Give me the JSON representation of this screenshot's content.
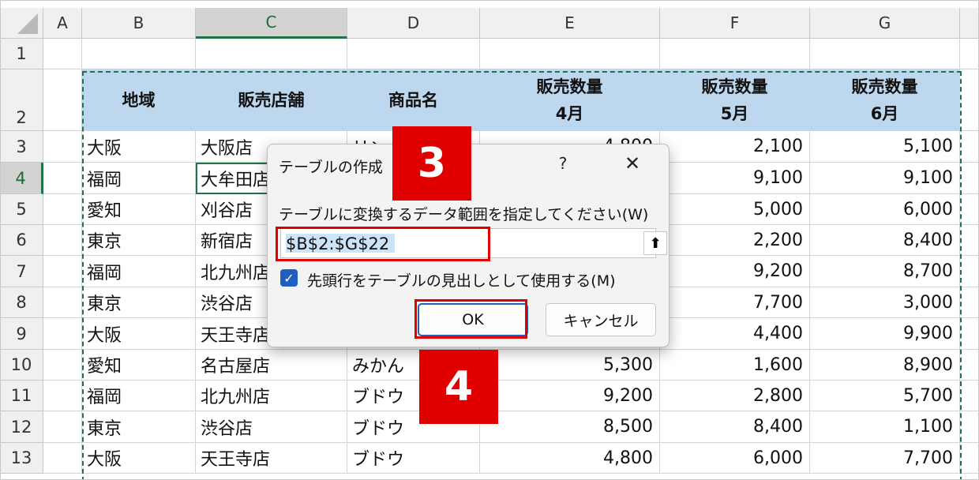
{
  "columns": [
    "A",
    "B",
    "C",
    "D",
    "E",
    "F",
    "G"
  ],
  "rows": [
    "1",
    "2",
    "3",
    "4",
    "5",
    "6",
    "7",
    "8",
    "9",
    "10",
    "11",
    "12",
    "13"
  ],
  "header_row": {
    "region": "地域",
    "store": "販売店舗",
    "product": "商品名",
    "apr": [
      "販売数量",
      "4月"
    ],
    "may": [
      "販売数量",
      "5月"
    ],
    "jun": [
      "販売数量",
      "6月"
    ]
  },
  "data_rows": [
    [
      "大阪",
      "大阪店",
      "リン",
      "4,800",
      "2,100",
      "5,100"
    ],
    [
      "福岡",
      "大牟田店",
      "",
      "",
      "9,100",
      "9,100"
    ],
    [
      "愛知",
      "刈谷店",
      "",
      "",
      "5,000",
      "6,000"
    ],
    [
      "東京",
      "新宿店",
      "",
      "",
      "2,200",
      "8,400"
    ],
    [
      "福岡",
      "北九州店",
      "",
      "",
      "9,200",
      "8,700"
    ],
    [
      "東京",
      "渋谷店",
      "",
      "",
      "7,700",
      "3,000"
    ],
    [
      "大阪",
      "天王寺店",
      "",
      "",
      "4,400",
      "9,900"
    ],
    [
      "愛知",
      "名古屋店",
      "みかん",
      "5,300",
      "1,600",
      "8,900"
    ],
    [
      "福岡",
      "北九州店",
      "ブドウ",
      "9,200",
      "2,800",
      "5,700"
    ],
    [
      "東京",
      "渋谷店",
      "ブドウ",
      "8,500",
      "8,400",
      "1,100"
    ],
    [
      "大阪",
      "天王寺店",
      "ブドウ",
      "4,800",
      "6,000",
      "7,700"
    ]
  ],
  "dialog": {
    "title": "テーブルの作成",
    "help": "?",
    "close": "✕",
    "prompt": "テーブルに変換するデータ範囲を指定してください(W)",
    "range_value": "$B$2:$G$22",
    "collapse_glyph": "⬆",
    "checkbox_label": "先頭行をテーブルの見出しとして使用する(M)",
    "checkbox_checked": true,
    "ok": "OK",
    "cancel": "キャンセル"
  },
  "badges": {
    "step3": "3",
    "step4": "4"
  },
  "colors": {
    "header_fill": "#bdd7ee",
    "accent": "#217346",
    "highlight": "#e00000"
  }
}
